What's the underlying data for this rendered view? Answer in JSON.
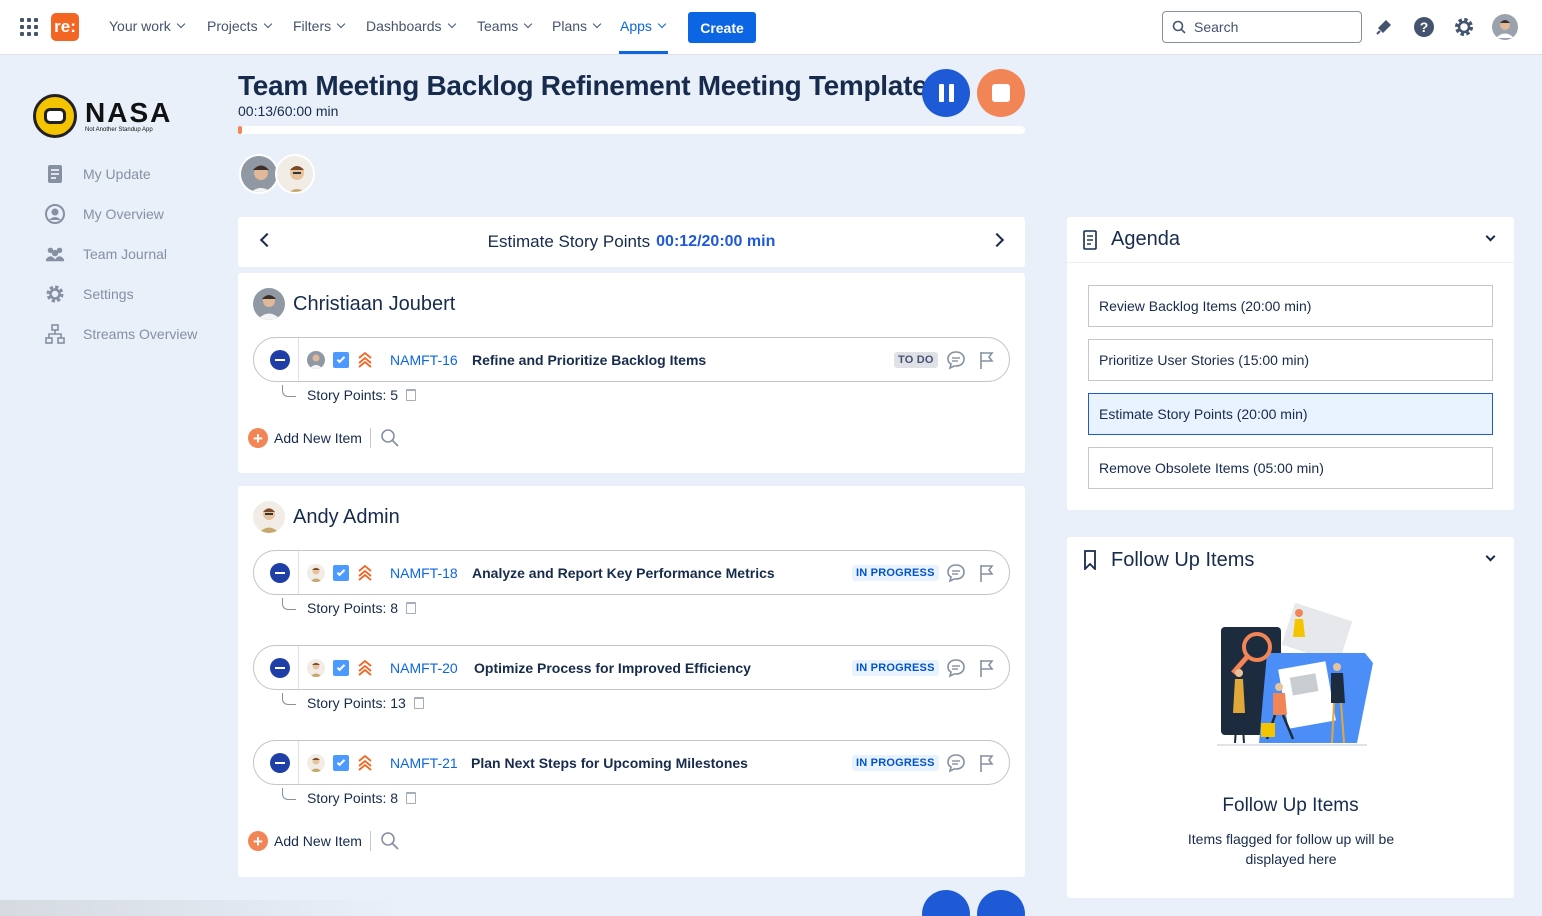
{
  "topnav": {
    "logo_text": "re:",
    "items": [
      {
        "label": "Your work"
      },
      {
        "label": "Projects"
      },
      {
        "label": "Filters"
      },
      {
        "label": "Dashboards"
      },
      {
        "label": "Teams"
      },
      {
        "label": "Plans"
      },
      {
        "label": "Apps",
        "active": true
      }
    ],
    "create_label": "Create",
    "search_placeholder": "Search",
    "icons": [
      "notifications-icon",
      "help-icon",
      "settings-icon",
      "profile-avatar"
    ]
  },
  "sidebar": {
    "logo_title": "NASA",
    "logo_subtitle": "Not Another Standup App",
    "items": [
      {
        "label": "My Update",
        "icon": "document-icon"
      },
      {
        "label": "My Overview",
        "icon": "user-circle-icon"
      },
      {
        "label": "Team Journal",
        "icon": "team-icon"
      },
      {
        "label": "Settings",
        "icon": "gear-icon"
      },
      {
        "label": "Streams Overview",
        "icon": "hierarchy-icon"
      }
    ]
  },
  "meeting": {
    "title": "Team Meeting Backlog Refinement Meeting Template",
    "timer": "00:13/60:00 min",
    "progress": 0.004,
    "accent": "#f28555",
    "primary": "#1f5ad6"
  },
  "step": {
    "title": "Estimate Story Points",
    "timer": "00:12/20:00 min"
  },
  "people": [
    {
      "name": "Christiaan Joubert",
      "issues": [
        {
          "key": "NAMFT-16",
          "summary": "Refine and Prioritize Backlog Items",
          "status": "TO DO",
          "story_points": "Story Points: 5"
        }
      ],
      "add_label": "Add New Item"
    },
    {
      "name": "Andy Admin",
      "issues": [
        {
          "key": "NAMFT-18",
          "summary": "Analyze and Report Key Performance Metrics",
          "status": "IN PROGRESS",
          "story_points": "Story Points: 8"
        },
        {
          "key": "NAMFT-20",
          "summary": "Optimize Process for Improved Efficiency",
          "status": "IN PROGRESS",
          "story_points": "Story Points: 13"
        },
        {
          "key": "NAMFT-21",
          "summary": "Plan Next Steps for Upcoming Milestones",
          "status": "IN PROGRESS",
          "story_points": "Story Points: 8"
        }
      ],
      "add_label": "Add New Item"
    }
  ],
  "agenda": {
    "title": "Agenda",
    "items": [
      {
        "label": "Review Backlog Items (20:00 min)"
      },
      {
        "label": "Prioritize User Stories (15:00 min)"
      },
      {
        "label": "Estimate Story Points (20:00 min)",
        "active": true
      },
      {
        "label": "Remove Obsolete Items (05:00 min)"
      }
    ]
  },
  "followup": {
    "title": "Follow Up Items",
    "empty_title": "Follow Up Items",
    "empty_desc": "Items flagged for follow up will be displayed here"
  }
}
